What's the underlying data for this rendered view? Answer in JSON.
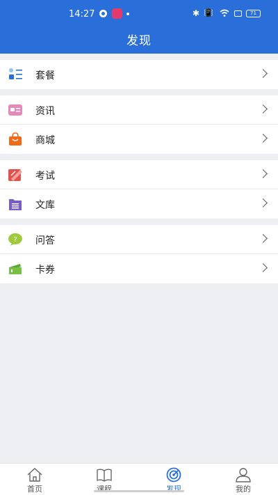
{
  "status_bar": {
    "time": "14:27",
    "battery": "71"
  },
  "header": {
    "title": "发现"
  },
  "groups": [
    {
      "items": [
        {
          "label": "套餐",
          "icon": "package-list-icon"
        }
      ]
    },
    {
      "items": [
        {
          "label": "资讯",
          "icon": "news-icon"
        },
        {
          "label": "商城",
          "icon": "shopping-bag-icon"
        }
      ]
    },
    {
      "items": [
        {
          "label": "考试",
          "icon": "exam-pen-icon"
        },
        {
          "label": "文库",
          "icon": "document-library-icon"
        }
      ]
    },
    {
      "items": [
        {
          "label": "问答",
          "icon": "question-bubble-icon"
        },
        {
          "label": "卡券",
          "icon": "coupon-ticket-icon"
        }
      ]
    }
  ],
  "tabbar": {
    "tabs": [
      {
        "label": "首页",
        "icon": "home-icon"
      },
      {
        "label": "课程",
        "icon": "book-icon"
      },
      {
        "label": "发现",
        "icon": "discover-icon",
        "active": true
      },
      {
        "label": "我的",
        "icon": "profile-icon"
      }
    ]
  },
  "colors": {
    "header": "#2a6fd9",
    "accent": "#2a6fd9",
    "background": "#eeeff2"
  }
}
